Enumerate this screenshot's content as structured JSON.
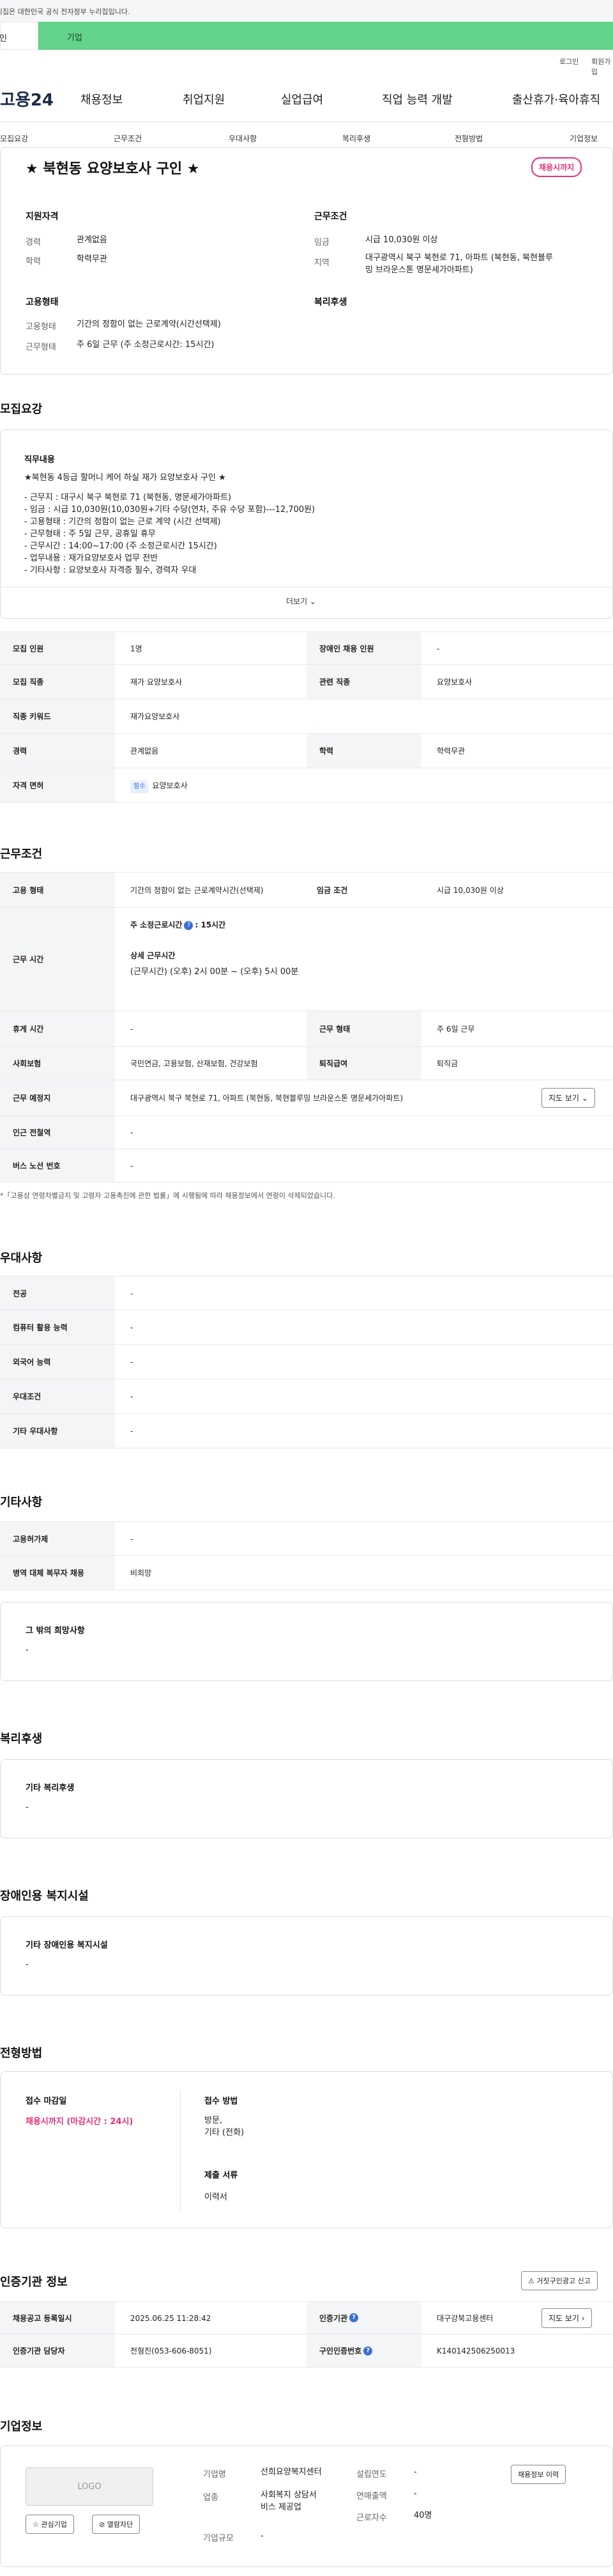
{
  "gov_notice": "이 누리집은 대한민국 공식 전자정부 누리집입니다.",
  "tabs": [
    "개인",
    "기업"
  ],
  "util": [
    "로그인",
    "회원가입"
  ],
  "logo": "고용24",
  "gnb": [
    "채용정보",
    "취업지원",
    "실업급여",
    "직업 능력 개발",
    "출산휴가·육아휴직"
  ],
  "anchors": [
    "모집요강",
    "근무조건",
    "우대사항",
    "복리후생",
    "전형방법",
    "기업정보"
  ],
  "job": {
    "title": "★ 북현동 요양보호사 구인 ★",
    "badge": "채용시까지",
    "qual_title": "지원자격",
    "cond_title": "근무조건",
    "emp_title": "고용형태",
    "welfare_title": "복리후생",
    "qual": [
      {
        "k": "경력",
        "v": "관계없음"
      },
      {
        "k": "학력",
        "v": "학력무관"
      }
    ],
    "cond": [
      {
        "k": "임금",
        "v": "시급 10,030원 이상"
      },
      {
        "k": "지역",
        "v": "대구광역시 북구 북현로 71, 아파트 (북현동, 북현블루\n밍 브라운스톤 명문세가아파트)"
      }
    ],
    "emp": [
      {
        "k": "고용형태",
        "v": "기간의 정함이 없는 근로계약(시간선택제)"
      },
      {
        "k": "근무형태",
        "v": "주 6일 근무 (주 소정근로시간: 15시간)"
      }
    ]
  },
  "recruit": {
    "section": "모집요강",
    "duty_title": "직무내용",
    "duty_lines": [
      "★북현동 4등급 할머니 케어 하실 재가 요양보호사 구인 ★",
      "",
      "- 근무지 : 대구시  북구 북현로 71 (북현동, 명문세가아파트)",
      "- 임금 : 시급 10,030원(10,030원+기타 수당(연차, 주유 수당 포함)---12,700원)",
      "- 고용형태 : 기간의 정함이 없는 근로 계약 (시간 선택제)",
      "- 근무형태 : 주 5일 근무, 공휴일 휴무",
      "- 근무시간 : 14:00~17:00 (주 소정근로시간 15시간)",
      "- 업무내용 : 재가요양보호사 업무 전반",
      "- 기타사항 : 요양보호사 자격증 필수, 경력자 우대"
    ],
    "more": "더보기",
    "rows": [
      {
        "k1": "모집 인원",
        "v1": "1명",
        "k2": "장애인 채용 인원",
        "v2": "-"
      },
      {
        "k1": "모집 직종",
        "v1": "재가 요양보호사",
        "k2": "관련 직종",
        "v2": "요양보호사"
      },
      {
        "k1": "직종 키워드",
        "v1": "재가요양보호사"
      },
      {
        "k1": "경력",
        "v1": "관계없음",
        "k2": "학력",
        "v2": "학력무관"
      },
      {
        "k1": "자격 면허",
        "v1": "요양보호사",
        "tag": "필수"
      }
    ]
  },
  "work": {
    "section": "근무조건",
    "r1": {
      "k1": "고용 형태",
      "v1": "기간의 정함이 없는 근로계약시간(선택제)",
      "k2": "임금 조건",
      "v2": "시급 10,030원 이상"
    },
    "r2": {
      "k1": "근무 시간",
      "l1": "주 소정근로시간",
      "l1v": ": 15시간",
      "l2": "상세 근무시간",
      "l2v": "(근무시간) (오후) 2시 00분 ~ (오후) 5시 00분"
    },
    "r3": {
      "k1": "휴게 시간",
      "v1": "-",
      "k2": "근무 형태",
      "v2": "주 6일 근무"
    },
    "r4": {
      "k1": "사회보험",
      "v1": "국민연금, 고용보험, 산재보험, 건강보험",
      "k2": "퇴직급여",
      "v2": "퇴직금"
    },
    "r5": {
      "k1": "근무 예정지",
      "v1": "대구광역시 북구 북현로 71, 아파트 (북현동, 북현블루밍 브라운스톤 명문세가아파트)",
      "btn": "지도 보기"
    },
    "r6": {
      "k1": "인근 전철역",
      "v1": "-"
    },
    "r7": {
      "k1": "버스 노선 번호",
      "v1": "-"
    },
    "note": "*「고용상 연령차별금지 및 고령자 고용촉진에 관한 법률」에 시행됨에 따라 채용정보에서 연령이 삭제되었습니다."
  },
  "pref": {
    "section": "우대사항",
    "rows": [
      {
        "k": "전공",
        "v": "-"
      },
      {
        "k": "컴퓨터 활용 능력",
        "v": "-"
      },
      {
        "k": "외국어 능력",
        "v": "-"
      },
      {
        "k": "우대조건",
        "v": "-"
      },
      {
        "k": "기타 우대사항",
        "v": "-"
      }
    ]
  },
  "etc": {
    "section": "기타사항",
    "rows": [
      {
        "k": "고용허가제",
        "v": "-"
      },
      {
        "k": "병역 대체 복무자 채용",
        "v": "비희망"
      }
    ],
    "box_title": "그 밖의 희망사항",
    "box_val": "-"
  },
  "welfare": {
    "section": "복리후생",
    "box_title": "기타 복리후생",
    "box_val": "-"
  },
  "disab": {
    "section": "장애인용 복지시설",
    "box_title": "기타 장애인용 복지시설",
    "box_val": "-"
  },
  "select": {
    "section": "전형방법",
    "deadline_t": "접수 마감일",
    "deadline_v": "채용시까지 (마감시간 : 24시)",
    "method_t": "접수 방법",
    "method_v": "방문,\n기타 (전화)",
    "docs_t": "제출 서류",
    "docs_v": "이력서"
  },
  "cert": {
    "section": "인증기관 정보",
    "report_btn": "거짓구인광고 신고",
    "r1": {
      "k1": "채용공고 등록일시",
      "v1": "2025.06.25 11:28:42",
      "k2": "인증기관",
      "v2": "대구강북고용센터",
      "btn": "지도 보기"
    },
    "r2": {
      "k1": "인증기관 담당자",
      "v1": "전형진(053-606-8051)",
      "k2": "구인인증번호",
      "v2": "K140142506250013"
    }
  },
  "company": {
    "section": "기업정보",
    "logo": "LOGO",
    "fav": "관심기업",
    "block": "열람차단",
    "rows": [
      {
        "k": "기업명",
        "v": "선희요양복지센터"
      },
      {
        "k": "업종",
        "v": "사회복지 상담서\n비스 제공업"
      },
      {
        "k": "기업규모",
        "v": "-"
      }
    ],
    "rows2": [
      {
        "k": "설립연도",
        "v": "-"
      },
      {
        "k": "연매출액",
        "v": "-"
      },
      {
        "k": "근로자수",
        "v": "40명"
      }
    ],
    "history_btn": "채용정보 이력"
  }
}
